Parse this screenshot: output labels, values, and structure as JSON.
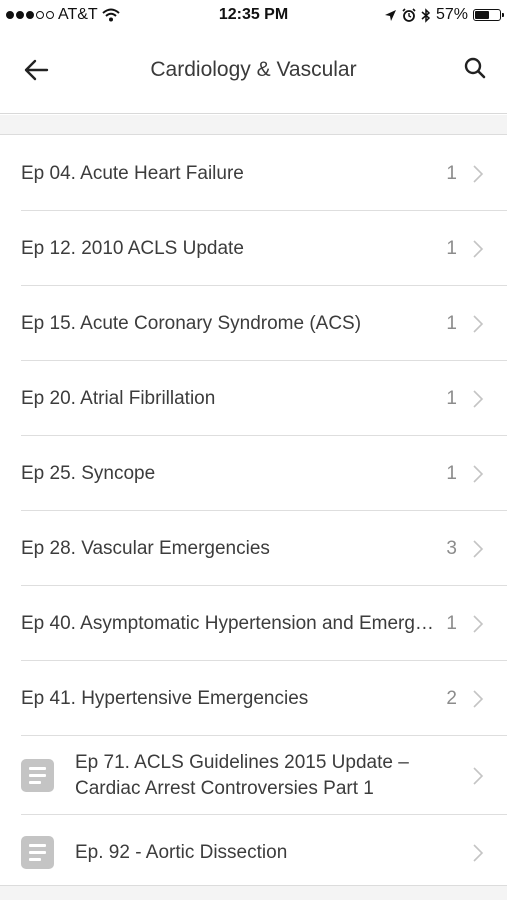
{
  "status_bar": {
    "carrier": "AT&T",
    "time": "12:35 PM",
    "battery": "57%",
    "battery_level": 0.57,
    "signal_bars_filled": 3,
    "signal_bars_total": 5
  },
  "nav": {
    "title": "Cardiology & Vascular",
    "back_icon": "arrow-left-icon",
    "search_icon": "search-icon"
  },
  "episodes": [
    {
      "label": "Ep 04. Acute Heart Failure",
      "count": "1"
    },
    {
      "label": "Ep 12. 2010 ACLS Update",
      "count": "1"
    },
    {
      "label": "Ep 15. Acute Coronary Syndrome (ACS)",
      "count": "1"
    },
    {
      "label": "Ep 20. Atrial Fibrillation",
      "count": "1"
    },
    {
      "label": "Ep 25. Syncope",
      "count": "1"
    },
    {
      "label": "Ep 28. Vascular Emergencies",
      "count": "3"
    },
    {
      "label": "Ep 40. Asymptomatic Hypertension and Emerg…",
      "count": "1"
    },
    {
      "label": "Ep 41. Hypertensive Emergencies",
      "count": "2"
    }
  ],
  "documents": [
    {
      "label": "Ep 71. ACLS Guidelines 2015 Update – Cardiac Arrest Controversies Part 1"
    },
    {
      "label": "Ep. 92 - Aortic Dissection"
    }
  ],
  "colors": {
    "text": "#3c3c3c",
    "count": "#8c8c8c",
    "separator": "#dedede",
    "doc_icon": "#c4c4c4"
  }
}
